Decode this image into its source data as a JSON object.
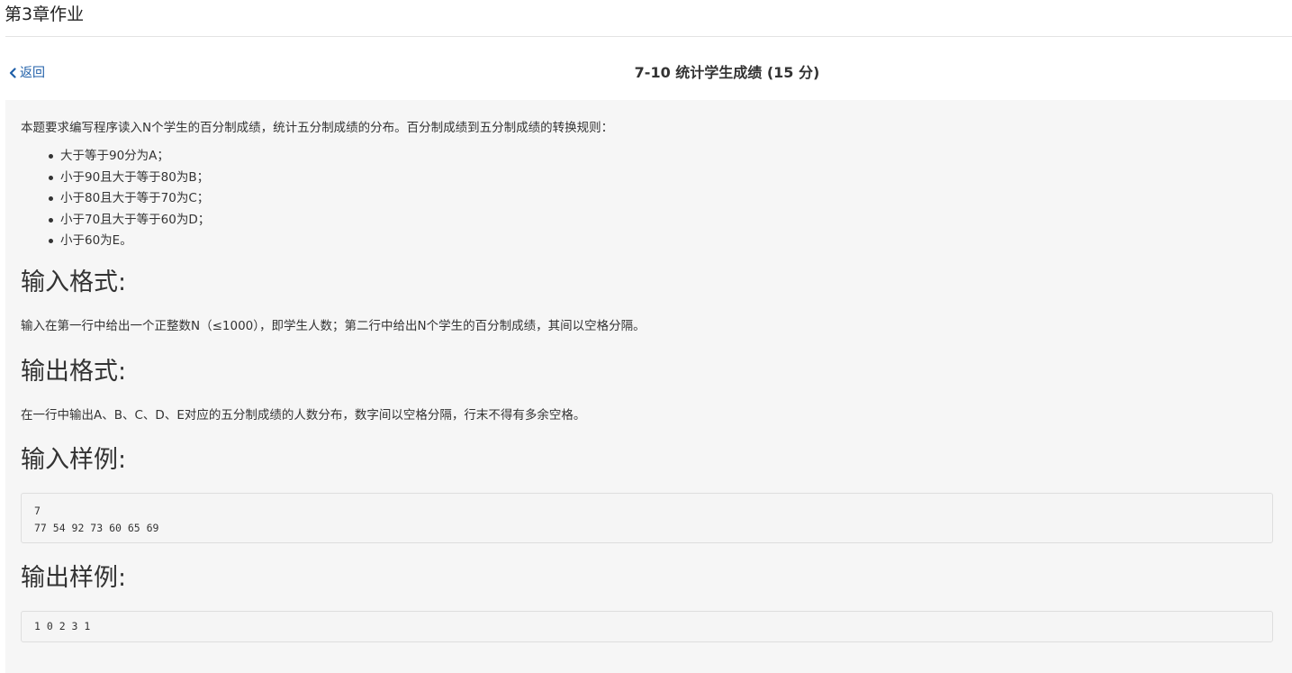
{
  "header": {
    "title": "第3章作业"
  },
  "nav": {
    "back_label": "返回"
  },
  "problem": {
    "title": "7-10 统计学生成绩 (15 分)",
    "intro": "本题要求编写程序读入N个学生的百分制成绩，统计五分制成绩的分布。百分制成绩到五分制成绩的转换规则：",
    "rules": [
      "大于等于90分为A；",
      "小于90且大于等于80为B；",
      "小于80且大于等于70为C；",
      "小于70且大于等于60为D；",
      "小于60为E。"
    ],
    "input_format_heading": "输入格式:",
    "input_format_text": "输入在第一行中给出一个正整数N（≤1000），即学生人数；第二行中给出N个学生的百分制成绩，其间以空格分隔。",
    "output_format_heading": "输出格式:",
    "output_format_text": "在一行中输出A、B、C、D、E对应的五分制成绩的人数分布，数字间以空格分隔，行末不得有多余空格。",
    "sample_input_heading": "输入样例:",
    "sample_input": "7\n77 54 92 73 60 65 69",
    "sample_output_heading": "输出样例:",
    "sample_output": "1 0 2 3 1"
  },
  "icons": {
    "back": "chevron-left-icon"
  },
  "colors": {
    "link": "#1f5fa8",
    "panel_bg": "#f6f6f6",
    "code_bg": "#f5f5f5",
    "code_border": "#dedede"
  }
}
